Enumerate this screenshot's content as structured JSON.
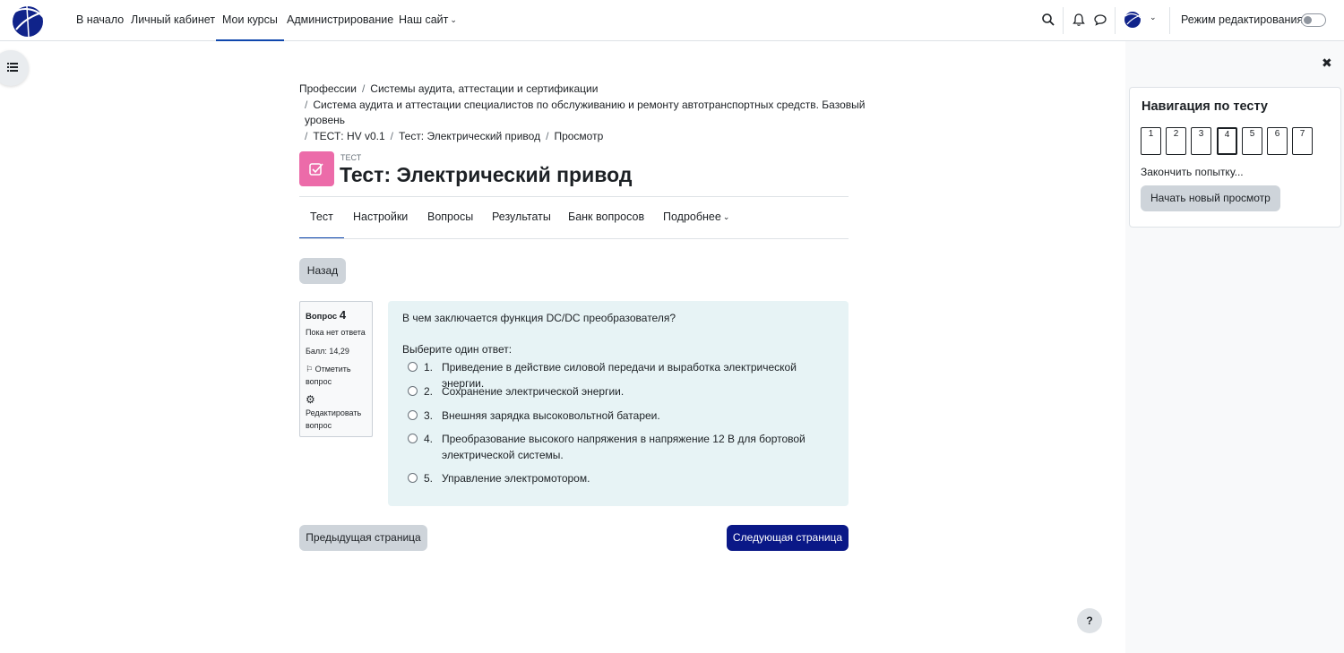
{
  "navbar": {
    "links": [
      "В начало",
      "Личный кабинет",
      "Мои курсы",
      "Администрирование",
      "Наш сайт"
    ],
    "active_link": "Мои курсы",
    "edit_mode_label": "Режим редактирования",
    "edit_mode_on": false
  },
  "breadcrumb": {
    "line1": [
      "Профессии",
      "Системы аудита, аттестации и сертификации"
    ],
    "line2": "Система аудита и аттестации специалистов по обслуживанию и ремонту автотранспортных средств. Базовый",
    "line3": "уровень",
    "line4": [
      "ТЕСТ: HV v0.1",
      "Тест: Электрический привод",
      "Просмотр"
    ]
  },
  "header": {
    "activity_type": "ТЕСТ",
    "title": "Тест: Электрический привод"
  },
  "tabs": [
    "Тест",
    "Настройки",
    "Вопросы",
    "Результаты",
    "Банк вопросов",
    "Подробнее"
  ],
  "active_tab": "Тест",
  "back_button": "Назад",
  "question_info": {
    "label": "Вопрос",
    "number": "4",
    "state": "Пока нет ответа",
    "grade": "Балл: 14,29",
    "flag_line1": "Отметить",
    "flag_line2": "вопрос",
    "edit_line1": "Редактировать",
    "edit_line2": "вопрос"
  },
  "question": {
    "text": "В чем заключается функция DC/DC преобразователя?",
    "prompt": "Выберите один ответ:",
    "answers": [
      {
        "num": "1.",
        "text": "Приведение в действие силовой передачи и выработка электрической энергии."
      },
      {
        "num": "2.",
        "text": "Сохранение электрической энергии."
      },
      {
        "num": "3.",
        "text": "Внешняя зарядка высоковольтной батареи."
      },
      {
        "num": "4.",
        "text": "Преобразование высокого напряжения в напряжение 12 В для бортовой электрической системы."
      },
      {
        "num": "5.",
        "text": "Управление электромотором."
      }
    ]
  },
  "footer_nav": {
    "prev": "Предыдущая страница",
    "next": "Следующая страница"
  },
  "quiz_nav": {
    "title": "Навигация по тесту",
    "questions": [
      "1",
      "2",
      "3",
      "4",
      "5",
      "6",
      "7"
    ],
    "current": "4",
    "finish": "Закончить попытку...",
    "new_attempt": "Начать новый просмотр"
  },
  "help": "?",
  "colors": {
    "primary": "#0a1887",
    "quiz_icon": "#ec6ba9",
    "question_bg": "#e7f3f5"
  }
}
